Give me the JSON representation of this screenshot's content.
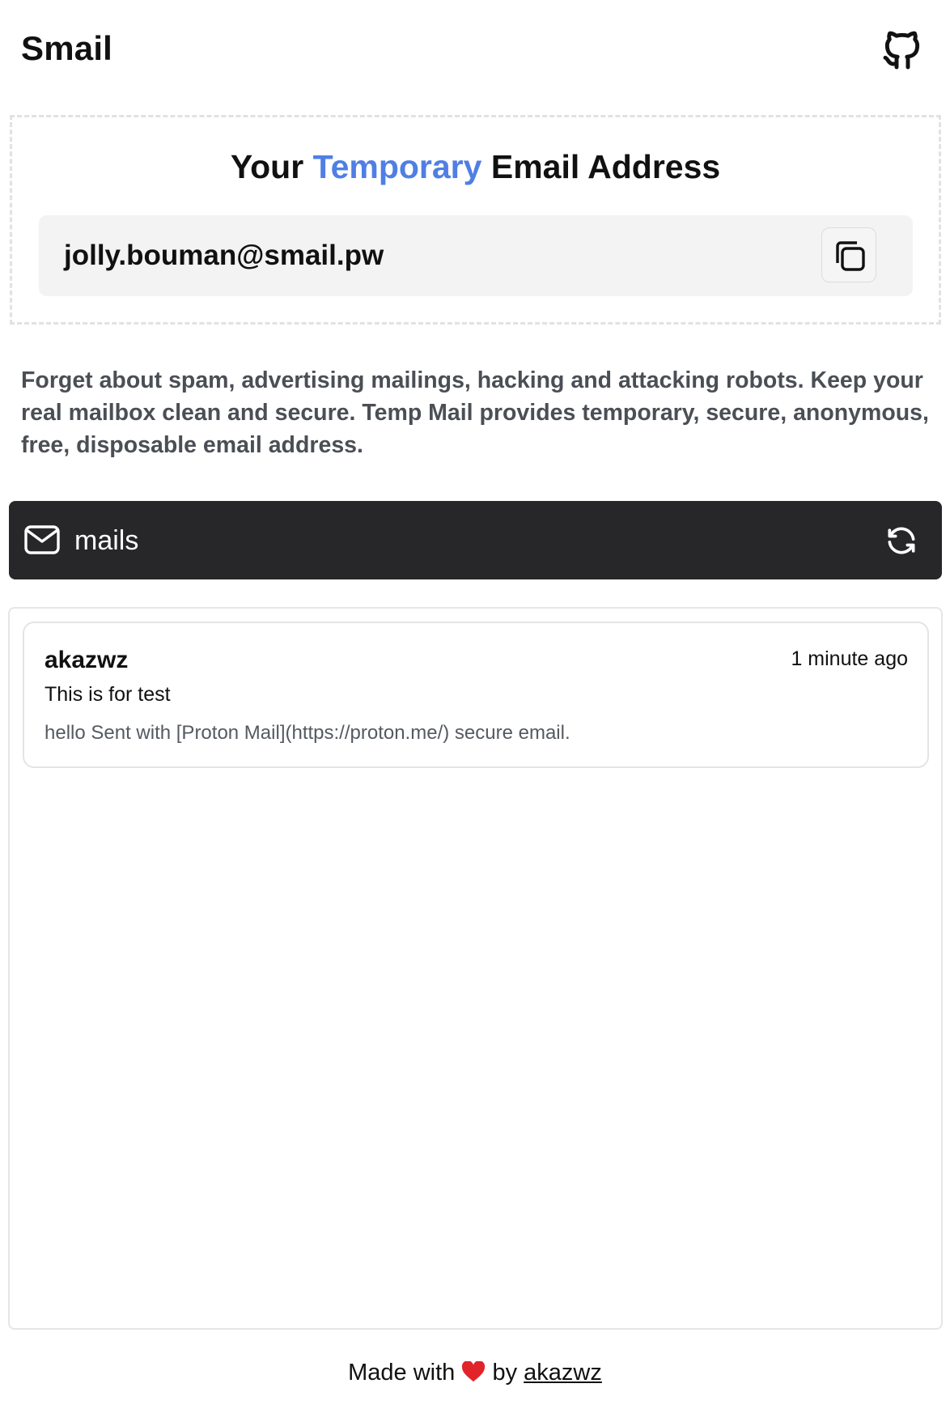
{
  "app": {
    "title": "Smail"
  },
  "address_card": {
    "title_before": "Your",
    "title_accent": "Temporary",
    "title_after": "Email Address",
    "email": "jolly.bouman@smail.pw"
  },
  "description": "Forget about spam, advertising mailings, hacking and attacking robots. Keep your real mailbox clean and secure. Temp Mail provides temporary, secure, anonymous, free, disposable email address.",
  "mails_bar": {
    "label": "mails"
  },
  "mails": [
    {
      "sender": "akazwz",
      "time": "1 minute ago",
      "subject": "This is for test",
      "preview": "hello Sent with [Proton Mail](https://proton.me/) secure email."
    }
  ],
  "footer": {
    "made_with": "Made with",
    "by": "by",
    "author": "akazwz"
  },
  "icons": {
    "github": "github-icon",
    "copy": "copy-icon",
    "mail": "mail-icon",
    "refresh": "refresh-icon",
    "heart": "heart-icon"
  },
  "colors": {
    "accent": "#4f7fe4",
    "mails_bar_bg": "#27272a",
    "email_row_bg": "#f3f3f3",
    "heart": "#e0242a"
  }
}
